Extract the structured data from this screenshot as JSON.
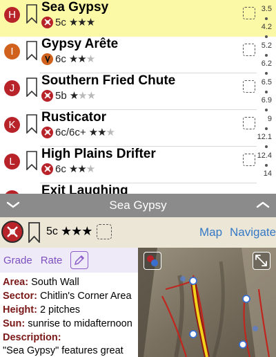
{
  "routes": [
    {
      "letter": "H",
      "name": "Sea Gypsy",
      "grade": "5c",
      "stars": 3,
      "type": "trad",
      "highlighted": true
    },
    {
      "letter": "I",
      "name": "Gypsy Arête",
      "grade": "6c",
      "stars": 2,
      "type": "sport",
      "highlighted": false
    },
    {
      "letter": "J",
      "name": "Southern Fried Chute",
      "grade": "5b",
      "stars": 1,
      "type": "trad",
      "highlighted": false
    },
    {
      "letter": "K",
      "name": "Rusticator",
      "grade": "6c/6c+",
      "stars": 2,
      "type": "trad",
      "highlighted": false
    },
    {
      "letter": "L",
      "name": "High Plains Drifter",
      "grade": "6c",
      "stars": 2,
      "type": "trad",
      "highlighted": false
    },
    {
      "letter": "",
      "name": "Exit Laughing",
      "grade": "",
      "stars": 0,
      "type": "trad",
      "highlighted": false
    }
  ],
  "index_labels": [
    "3.5",
    "4.2",
    "5.2",
    "6.2",
    "6.5",
    "6.9",
    "9",
    "12.1",
    "12.4",
    "14"
  ],
  "panel": {
    "title": "Sea Gypsy",
    "grade": "5c",
    "stars": "★★★",
    "map_label": "Map",
    "navigate_label": "Navigate",
    "grade_action": "Grade",
    "rate_action": "Rate"
  },
  "info": {
    "area_label": "Area:",
    "area_value": "South Wall",
    "sector_label": "Sector:",
    "sector_value": "Chitlin's Corner Area",
    "height_label": "Height:",
    "height_value": "2 pitches",
    "sun_label": "Sun:",
    "sun_value": "sunrise to midafternoon",
    "description_label": "Description:",
    "description_text": "\"Sea Gypsy\" features great climbing and exposure on"
  },
  "colors": {
    "highlight": "#fbf8a6",
    "letter_circle": "#b8232a",
    "letter_circle_alt": "#d0621e",
    "link": "#3478c6",
    "action_purple": "#7c4fc0",
    "bar_grey": "#8b8b8b",
    "header_beige": "#ece6d6"
  }
}
